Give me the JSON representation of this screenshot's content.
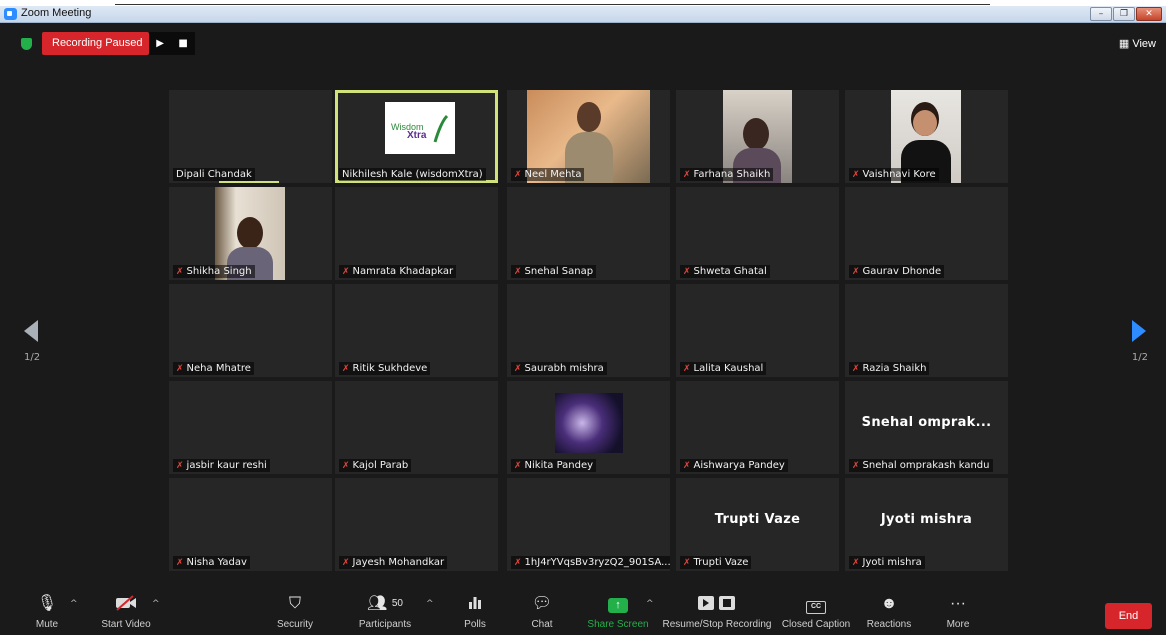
{
  "window": {
    "title": "Zoom Meeting",
    "controls": [
      "–",
      "❐",
      "✕"
    ]
  },
  "recording": {
    "status": "Recording Paused"
  },
  "view_label": "View",
  "pager": {
    "current": "1/2"
  },
  "participants": [
    {
      "name": "Dipali Chandak",
      "muted": false,
      "video": false
    },
    {
      "name": "Nikhilesh Kale (wisdomXtra)",
      "muted": false,
      "video": true,
      "active": true
    },
    {
      "name": "Neel Mehta",
      "muted": true,
      "video": true
    },
    {
      "name": "Farhana Shaikh",
      "muted": true,
      "video": true
    },
    {
      "name": "Vaishnavi Kore",
      "muted": true,
      "video": true
    },
    {
      "name": "Shikha Singh",
      "muted": true,
      "video": true
    },
    {
      "name": "Namrata Khadapkar",
      "muted": true,
      "video": false
    },
    {
      "name": "Snehal Sanap",
      "muted": true,
      "video": false
    },
    {
      "name": "Shweta Ghatal",
      "muted": true,
      "video": false
    },
    {
      "name": "Gaurav Dhonde",
      "muted": true,
      "video": false
    },
    {
      "name": "Neha Mhatre",
      "muted": true,
      "video": false
    },
    {
      "name": "Ritik Sukhdeve",
      "muted": true,
      "video": false
    },
    {
      "name": "Saurabh mishra",
      "muted": true,
      "video": false
    },
    {
      "name": "Lalita Kaushal",
      "muted": true,
      "video": false
    },
    {
      "name": "Razia Shaikh",
      "muted": true,
      "video": false
    },
    {
      "name": "jasbir kaur reshi",
      "muted": true,
      "video": false
    },
    {
      "name": "Kajol Parab",
      "muted": true,
      "video": false
    },
    {
      "name": "Nikita  Pandey",
      "muted": true,
      "video": true
    },
    {
      "name": "Aishwarya Pandey",
      "muted": true,
      "video": false
    },
    {
      "name": "Snehal  omprakash  kandu",
      "muted": true,
      "video": false,
      "display": "Snehal  omprak..."
    },
    {
      "name": "Nisha Yadav",
      "muted": true,
      "video": false
    },
    {
      "name": "Jayesh Mohandkar",
      "muted": true,
      "video": false
    },
    {
      "name": "1hJ4rYVqsBv3ryzQ2_901SA...",
      "muted": true,
      "video": false
    },
    {
      "name": "Trupti Vaze",
      "muted": true,
      "video": false,
      "display": "Trupti Vaze"
    },
    {
      "name": "Jyoti  mishra",
      "muted": true,
      "video": false,
      "display": "Jyoti  mishra"
    }
  ],
  "toolbar": {
    "mute": "Mute",
    "start_video": "Start Video",
    "security": "Security",
    "participants": "Participants",
    "participants_count": "50",
    "polls": "Polls",
    "chat": "Chat",
    "share_screen": "Share Screen",
    "recording": "Resume/Stop Recording",
    "closed_caption": "Closed Caption",
    "cc_icon": "CC",
    "reactions": "Reactions",
    "more": "More",
    "end": "End"
  },
  "colors": {
    "record": "#d6262b",
    "share": "#23b04a",
    "active_speaker": "#d2e27a",
    "accent": "#2d8cff"
  }
}
